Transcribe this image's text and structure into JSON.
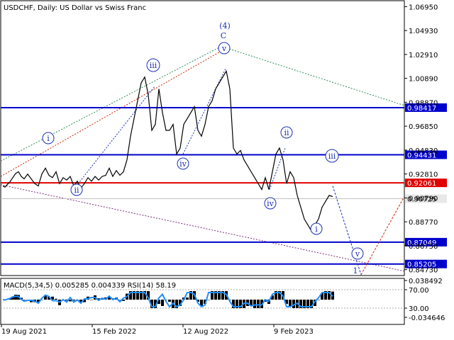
{
  "header": {
    "symbol": "USDCHF",
    "timeframe": "Daily",
    "description": "US Dollar vs Swiss Franc"
  },
  "indicator_header": {
    "macd": "MACD(5,34,5) 0.005285 0.004339",
    "rsi": "RSI(14) 58.19"
  },
  "colors": {
    "level_blue": "#0000cc",
    "level_red": "#e00000",
    "price_line": "#000000",
    "macd_line": "#1e90ff",
    "green_label": "#2e8b57",
    "red_label": "#cc2200",
    "wave_label": "#1b2fb5"
  },
  "chart_data": [
    {
      "type": "line",
      "panel": "price",
      "x_ticks": [
        "19 Aug 2021",
        "15 Feb 2022",
        "12 Aug 2022",
        "9 Feb 2023"
      ],
      "y_ticks": [
        "1.06950",
        "1.04930",
        "1.02910",
        "1.00890",
        "0.98870",
        "0.96850",
        "0.94830",
        "0.92810",
        "0.90790",
        "0.88770",
        "0.86750",
        "0.84730"
      ],
      "ylim": [
        0.8423,
        1.0745
      ],
      "series": [
        {
          "x": [
            0,
            3,
            6,
            10,
            14,
            18,
            22,
            26,
            30,
            35,
            40,
            45,
            50,
            55,
            60,
            65,
            70,
            75,
            80,
            85,
            90,
            95,
            100,
            105,
            110,
            115,
            120,
            125,
            130,
            135,
            140,
            145,
            150,
            155,
            160,
            165,
            170,
            175,
            180,
            185,
            190,
            195,
            200,
            205,
            210,
            215,
            220,
            225,
            230,
            235,
            240,
            245,
            250,
            255,
            260,
            265,
            270,
            275,
            280,
            285,
            290,
            295,
            300,
            305,
            310,
            315,
            320,
            325,
            330,
            335,
            340,
            345,
            350,
            355,
            360,
            365,
            370,
            375,
            380,
            385,
            390,
            395,
            400,
            405,
            410,
            415,
            420,
            425,
            430,
            435,
            440,
            445,
            450,
            455,
            460,
            465
          ],
          "values": [
            0.918,
            0.917,
            0.919,
            0.9215,
            0.925,
            0.9285,
            0.93,
            0.926,
            0.924,
            0.928,
            0.924,
            0.92,
            0.918,
            0.928,
            0.933,
            0.927,
            0.925,
            0.93,
            0.92,
            0.925,
            0.923,
            0.926,
            0.918,
            0.922,
            0.916,
            0.92,
            0.925,
            0.922,
            0.926,
            0.923,
            0.926,
            0.927,
            0.933,
            0.926,
            0.931,
            0.927,
            0.93,
            0.94,
            0.96,
            0.975,
            0.99,
            1.005,
            1.01,
            0.995,
            0.965,
            0.97,
            1.0,
            0.98,
            0.965,
            0.965,
            0.97,
            0.945,
            0.95,
            0.97,
            0.975,
            0.98,
            0.985,
            0.965,
            0.96,
            0.97,
            0.985,
            0.99,
            1.0,
            1.005,
            1.01,
            1.015,
            1.0,
            0.95,
            0.945,
            0.948,
            0.94,
            0.935,
            0.93,
            0.925,
            0.92,
            0.915,
            0.925,
            0.915,
            0.93,
            0.945,
            0.95,
            0.94,
            0.92,
            0.93,
            0.925,
            0.91,
            0.9,
            0.89,
            0.885,
            0.88,
            0.885,
            0.89,
            0.9,
            0.905,
            0.91,
            0.909
          ]
        }
      ],
      "price_levels": [
        {
          "value": 0.98417,
          "label": "0.98417",
          "color": "blue"
        },
        {
          "value": 0.94431,
          "label": "0.94431",
          "color": "blue"
        },
        {
          "value": 0.92061,
          "label": "0.92061",
          "color": "red"
        },
        {
          "value": 0.87049,
          "label": "0.87049",
          "color": "blue"
        },
        {
          "value": 0.85205,
          "label": "0.85205",
          "color": "blue"
        }
      ],
      "current_price": {
        "value": 0.90725,
        "label": "0.90725"
      },
      "wave_labels": [
        {
          "text": "(4)",
          "color": "green"
        },
        {
          "text": "C",
          "color": "red"
        },
        {
          "text": "v",
          "color": "blue"
        },
        {
          "text": "iii",
          "color": "blue"
        },
        {
          "text": "i",
          "color": "blue"
        },
        {
          "text": "ii",
          "color": "blue"
        },
        {
          "text": "iv",
          "color": "blue"
        },
        {
          "text": "ii",
          "color": "blue"
        },
        {
          "text": "iv",
          "color": "blue"
        },
        {
          "text": "i",
          "color": "blue"
        },
        {
          "text": "iii",
          "color": "blue"
        },
        {
          "text": "v",
          "color": "blue"
        },
        {
          "text": "1",
          "color": "red"
        }
      ],
      "forecast_points": [
        [
          465,
          0.918
        ],
        [
          505,
          0.843
        ],
        [
          565,
          0.908
        ]
      ]
    },
    {
      "type": "bar",
      "panel": "indicator",
      "y_ticks": [
        "0.038492",
        "70.00",
        "30.00",
        "-0.034646"
      ],
      "ylim": [
        -0.034646,
        0.038492
      ],
      "rsi_levels": [
        70,
        30
      ]
    }
  ]
}
